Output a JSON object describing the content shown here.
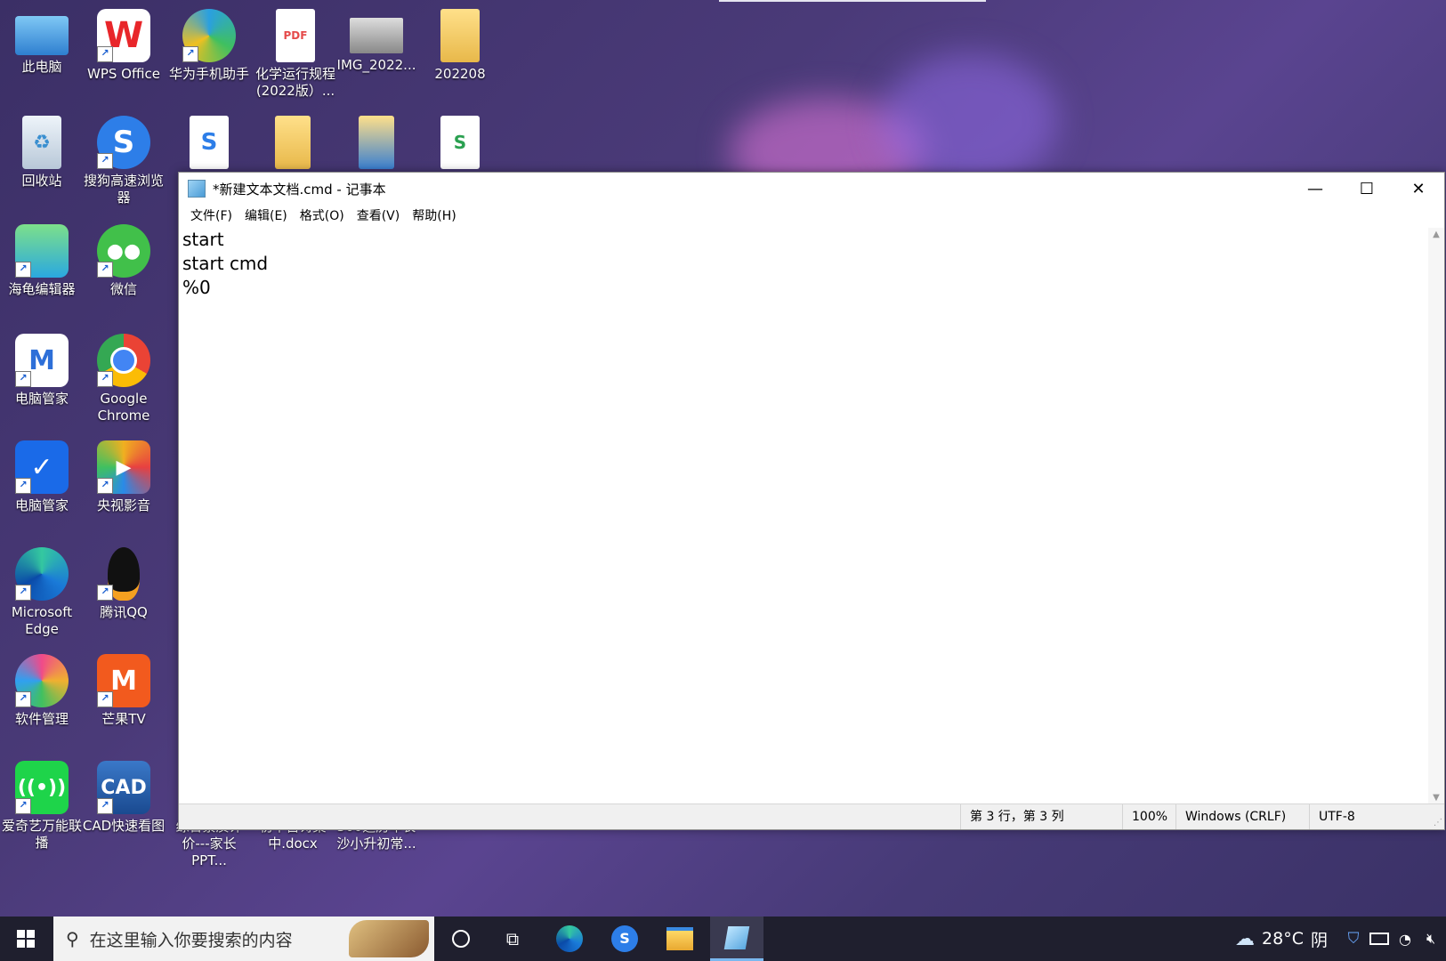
{
  "desktop": {
    "icons": [
      {
        "label": "此电脑"
      },
      {
        "label": "WPS Office"
      },
      {
        "label": "华为手机助手"
      },
      {
        "label": "化学运行规程(2022版）..."
      },
      {
        "label": "IMG_2022..."
      },
      {
        "label": "202208"
      },
      {
        "label": "回收站"
      },
      {
        "label": "搜狗高速浏览器"
      },
      {
        "label": "海龟编辑器"
      },
      {
        "label": "微信"
      },
      {
        "label": "电脑管家"
      },
      {
        "label": "Google Chrome"
      },
      {
        "label": "电脑管家"
      },
      {
        "label": "央视影音"
      },
      {
        "label": "Microsoft Edge"
      },
      {
        "label": "腾讯QQ"
      },
      {
        "label": "软件管理"
      },
      {
        "label": "芒果TV"
      },
      {
        "label": "爱奇艺万能联播"
      },
      {
        "label": "CAD快速看图"
      },
      {
        "label": "综合素质评价---家长PPT..."
      },
      {
        "label": "初中古诗集中.docx"
      },
      {
        "label": "300道历年长沙小升初常..."
      }
    ]
  },
  "notepad": {
    "title": "*新建文本文档.cmd - 记事本",
    "controls": {
      "minimize": "—",
      "maximize": "☐",
      "close": "✕"
    },
    "menu": [
      "文件(F)",
      "编辑(E)",
      "格式(O)",
      "查看(V)",
      "帮助(H)"
    ],
    "lines": [
      "start",
      "start cmd",
      "%0"
    ],
    "status": {
      "position": "第 3 行，第 3 列",
      "zoom": "100%",
      "line_ending": "Windows (CRLF)",
      "encoding": "UTF-8"
    }
  },
  "taskbar": {
    "search_placeholder": "在这里输入你要搜索的内容",
    "weather_temp": "28°C",
    "weather_text": "阴"
  }
}
